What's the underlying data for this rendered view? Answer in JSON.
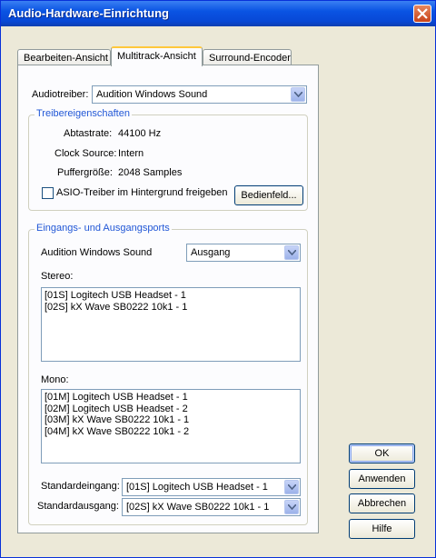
{
  "window": {
    "title": "Audio-Hardware-Einrichtung"
  },
  "tabs": [
    {
      "label": "Bearbeiten-Ansicht"
    },
    {
      "label": "Multitrack-Ansicht"
    },
    {
      "label": "Surround-Encoder"
    }
  ],
  "active_tab": "Multitrack-Ansicht",
  "driver": {
    "label": "Audiotreiber:",
    "value": "Audition Windows Sound"
  },
  "driver_props": {
    "title": "Treibereigenschaften",
    "sample_rate_label": "Abtastrate:",
    "sample_rate_value": "44100 Hz",
    "clock_label": "Clock Source:",
    "clock_value": "Intern",
    "buffer_label": "Puffergröße:",
    "buffer_value": "2048 Samples",
    "asio_checkbox_label": "ASIO-Treiber im Hintergrund freigeben",
    "asio_checked": false,
    "control_panel_button": "Bedienfeld..."
  },
  "ports": {
    "title": "Eingangs- und Ausgangsports",
    "device_label": "Audition Windows Sound",
    "direction_value": "Ausgang",
    "stereo_label": "Stereo:",
    "stereo_items": [
      "[01S] Logitech USB Headset - 1",
      "[02S] kX Wave SB0222 10k1  - 1"
    ],
    "mono_label": "Mono:",
    "mono_items": [
      "[01M] Logitech USB Headset - 1",
      "[02M] Logitech USB Headset - 2",
      "[03M] kX Wave SB0222 10k1  - 1",
      "[04M] kX Wave SB0222 10k1  - 2"
    ],
    "default_input_label": "Standardeingang:",
    "default_input_value": "[01S] Logitech USB Headset - 1",
    "default_output_label": "Standardausgang:",
    "default_output_value": "[02S] kX Wave SB0222 10k1  - 1"
  },
  "buttons": {
    "ok": "OK",
    "apply": "Anwenden",
    "cancel": "Abbrechen",
    "help": "Hilfe"
  },
  "colors": {
    "titlebar": "#0a54e3",
    "group_title": "#2157d6",
    "dialog_bg": "#ece9d8"
  }
}
